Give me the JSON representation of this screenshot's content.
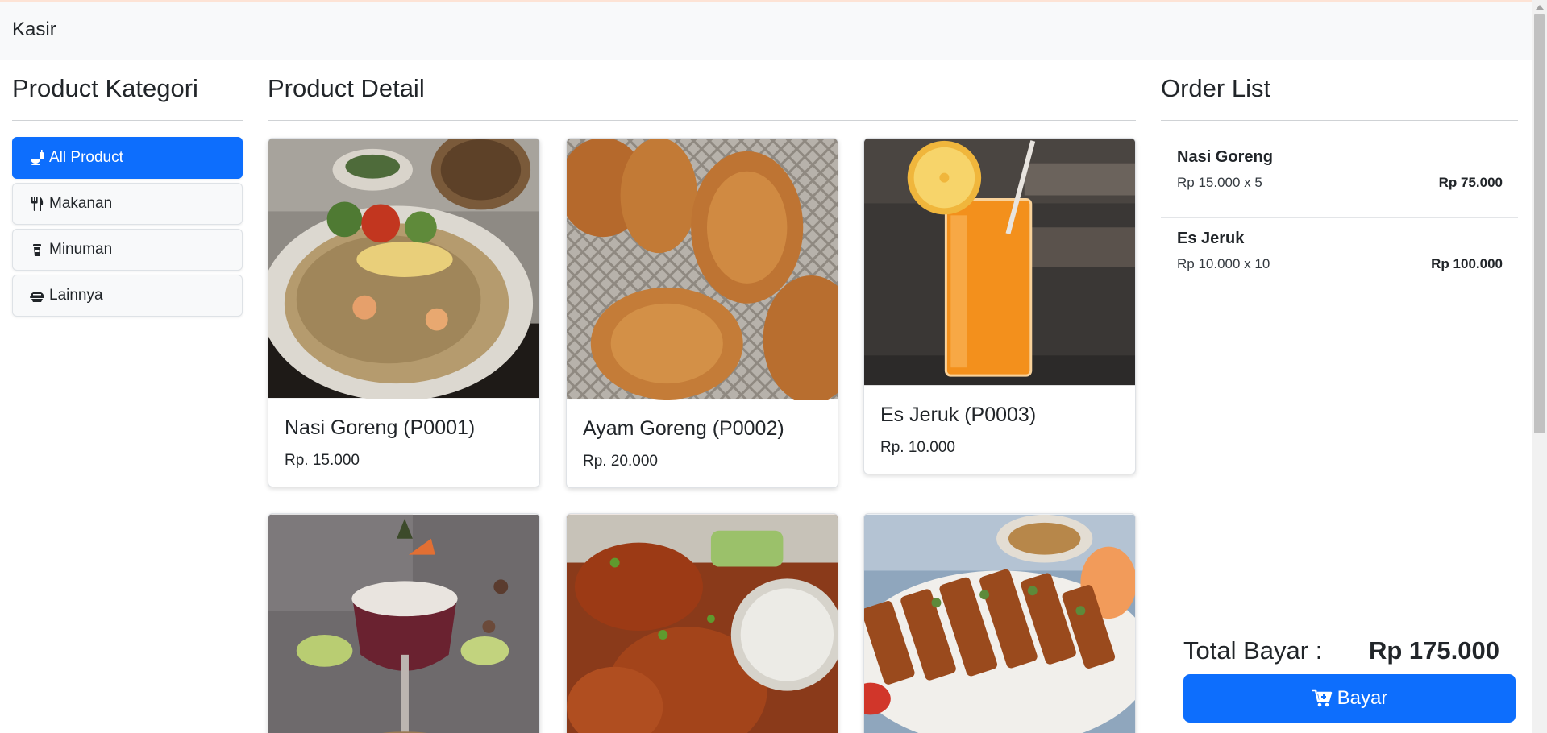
{
  "app": {
    "brand": "Kasir"
  },
  "categories": {
    "title": "Product Kategori",
    "items": [
      {
        "label": "All Product",
        "icon": "food-drink-icon",
        "active": true
      },
      {
        "label": "Makanan",
        "icon": "utensils-icon",
        "active": false
      },
      {
        "label": "Minuman",
        "icon": "cup-icon",
        "active": false
      },
      {
        "label": "Lainnya",
        "icon": "dish-icon",
        "active": false
      }
    ]
  },
  "products": {
    "title": "Product Detail",
    "items": [
      {
        "name": "Nasi Goreng (P0001)",
        "price": "Rp. 15.000",
        "image": "fried-rice-photo"
      },
      {
        "name": "Ayam Goreng (P0002)",
        "price": "Rp. 20.000",
        "image": "fried-chicken-photo"
      },
      {
        "name": "Es Jeruk (P0003)",
        "price": "Rp. 10.000",
        "image": "orange-juice-photo"
      },
      {
        "name": "",
        "price": "",
        "image": "cocktail-photo"
      },
      {
        "name": "",
        "price": "",
        "image": "chicken-wings-photo"
      },
      {
        "name": "",
        "price": "",
        "image": "satay-photo"
      }
    ]
  },
  "order": {
    "title": "Order List",
    "items": [
      {
        "name": "Nasi Goreng",
        "qty": "Rp 15.000 x 5",
        "subtotal": "Rp 75.000"
      },
      {
        "name": "Es Jeruk",
        "qty": "Rp 10.000 x 10",
        "subtotal": "Rp 100.000"
      }
    ],
    "total_label": "Total Bayar :",
    "total_value": "Rp 175.000",
    "pay_label": "Bayar",
    "pay_icon": "cart-icon"
  },
  "colors": {
    "primary": "#0d6efd",
    "navbar": "#f8f9fa"
  }
}
